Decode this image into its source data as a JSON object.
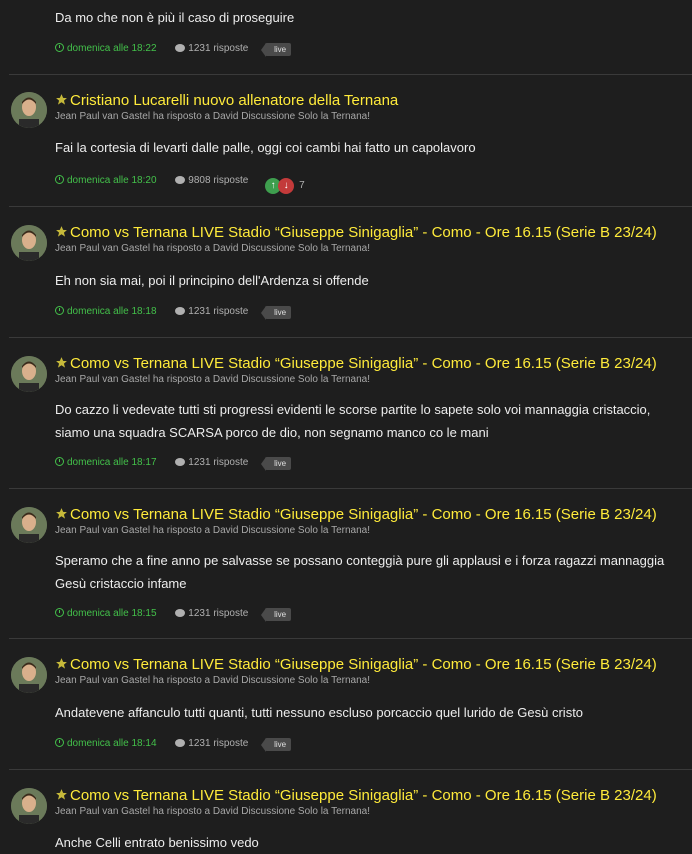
{
  "posts": [
    {
      "body": "Da mo che non è più il caso di proseguire",
      "when": "domenica alle 18:22",
      "replies": "1231 risposte",
      "tag": "live"
    },
    {
      "title": "Cristiano Lucarelli nuovo allenatore della Ternana",
      "subtitle": "Jean Paul van Gastel ha risposto a David Discussione Solo la Ternana!",
      "body": "Fai la cortesia di levarti dalle palle, oggi coi cambi hai fatto un capolavoro",
      "when": "domenica alle 18:20",
      "replies": "9808 risposte",
      "votes": "7"
    },
    {
      "title": "Como vs Ternana LIVE Stadio “Giuseppe Sinigaglia” - Como - Ore 16.15 (Serie B 23/24)",
      "subtitle": "Jean Paul van Gastel ha risposto a David Discussione Solo la Ternana!",
      "body": "Eh non sia mai, poi il principino dell'Ardenza si offende",
      "when": "domenica alle 18:18",
      "replies": "1231 risposte",
      "tag": "live"
    },
    {
      "title": "Como vs Ternana LIVE Stadio “Giuseppe Sinigaglia” - Como - Ore 16.15 (Serie B 23/24)",
      "subtitle": "Jean Paul van Gastel ha risposto a David Discussione Solo la Ternana!",
      "body": "Do cazzo li vedevate tutti sti progressi evidenti le scorse partite lo sapete solo voi mannaggia cristaccio, siamo una squadra SCARSA porco de dio, non segnamo manco co le mani",
      "when": "domenica alle 18:17",
      "replies": "1231 risposte",
      "tag": "live"
    },
    {
      "title": "Como vs Ternana LIVE Stadio “Giuseppe Sinigaglia” - Como - Ore 16.15 (Serie B 23/24)",
      "subtitle": "Jean Paul van Gastel ha risposto a David Discussione Solo la Ternana!",
      "body": "Speramo che a fine anno pe salvasse se possano conteggià pure gli applausi e i forza ragazzi mannaggia Gesù cristaccio infame",
      "when": "domenica alle 18:15",
      "replies": "1231 risposte",
      "tag": "live"
    },
    {
      "title": "Como vs Ternana LIVE Stadio “Giuseppe Sinigaglia” - Como - Ore 16.15 (Serie B 23/24)",
      "subtitle": "Jean Paul van Gastel ha risposto a David Discussione Solo la Ternana!",
      "body": "Andatevene affanculo tutti quanti, tutti nessuno escluso porcaccio quel lurido de Gesù cristo",
      "when": "domenica alle 18:14",
      "replies": "1231 risposte",
      "tag": "live"
    },
    {
      "title": "Como vs Ternana LIVE Stadio “Giuseppe Sinigaglia” - Como - Ore 16.15 (Serie B 23/24)",
      "subtitle": "Jean Paul van Gastel ha risposto a David Discussione Solo la Ternana!",
      "body": "Anche Celli entrato benissimo vedo"
    }
  ],
  "colors": {
    "background": "#1e1e1e",
    "title": "#ffeb3b",
    "timestamp": "#43c04a",
    "upvote": "#3e9e4e",
    "downvote": "#c33a3a"
  },
  "icons": [
    "star-icon",
    "clock-icon",
    "comment-bubble-icon",
    "tag-icon",
    "upvote-icon",
    "downvote-icon",
    "avatar"
  ]
}
